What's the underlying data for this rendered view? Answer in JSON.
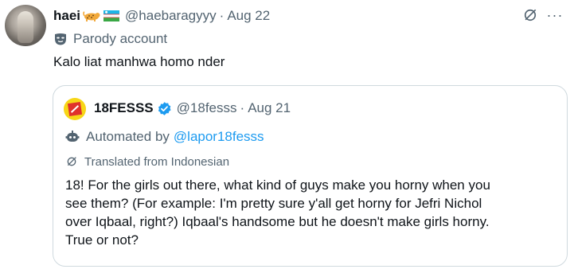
{
  "tweet": {
    "display_name": "haei",
    "name_emojis": [
      "leopard",
      "flag"
    ],
    "handle": "@haebaragyyy",
    "separator": "·",
    "date": "Aug 22",
    "parody_label": "Parody account",
    "text": "Kalo liat manhwa homo nder"
  },
  "quote": {
    "display_name": "18FESSS",
    "verified": true,
    "handle": "@18fesss",
    "separator": "·",
    "date": "Aug 21",
    "automated_prefix": "Automated by",
    "automated_link": "@lapor18fesss",
    "translated_label": "Translated from Indonesian",
    "text_lines": [
      "18! For the girls out there, what kind of guys make you horny when you",
      "see them? (For example: I'm pretty sure y'all get horny for Jefri Nichol",
      "over Iqbaal, right?) Iqbaal's handsome but he doesn't make girls horny.",
      "True or not?"
    ]
  },
  "colors": {
    "text_primary": "#0f1419",
    "text_secondary": "#536471",
    "link": "#1d9bf0",
    "border": "#cfd9de",
    "verified": "#1d9bf0"
  },
  "more_label": "···"
}
